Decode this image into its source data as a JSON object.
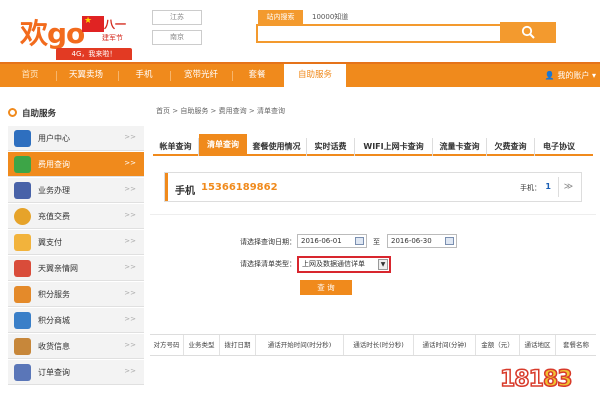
{
  "header": {
    "logo_text": "go",
    "promo_title": "八一",
    "promo_sub": "建军节",
    "badge": "4G，我来啦！",
    "region_1": "江苏",
    "region_2": "南京",
    "search_label": "站内搜索",
    "search_hint": "10000知道",
    "search_value": ""
  },
  "nav": {
    "items": [
      "首页",
      "天翼卖场",
      "手机",
      "宽带光纤",
      "套餐",
      "自助服务"
    ],
    "account": "我的账户"
  },
  "sidebar": {
    "title": "自助服务",
    "items": [
      {
        "label": "用户中心",
        "icon": "user-icon"
      },
      {
        "label": "费用查询",
        "icon": "search-icon"
      },
      {
        "label": "业务办理",
        "icon": "list-icon"
      },
      {
        "label": "充值交费",
        "icon": "yen-icon"
      },
      {
        "label": "翼支付",
        "icon": "wallet-icon"
      },
      {
        "label": "天翼亲情网",
        "icon": "family-icon"
      },
      {
        "label": "积分服务",
        "icon": "points-icon"
      },
      {
        "label": "积分商城",
        "icon": "mall-icon"
      },
      {
        "label": "收货信息",
        "icon": "box-icon"
      },
      {
        "label": "订单查询",
        "icon": "order-icon"
      }
    ],
    "arrow": ">>"
  },
  "breadcrumb": "首页 > 自助服务 > 费用查询 > 清单查询",
  "tabs": [
    "帐单查询",
    "清单查询",
    "套餐使用情况",
    "实时话费",
    "WIFI上网卡查询",
    "流量卡查询",
    "欠费查询",
    "电子协议"
  ],
  "phone": {
    "label": "手机",
    "number": "15366189862",
    "count_label": "手机：",
    "count": "1",
    "toggle": "≫"
  },
  "query": {
    "date_label": "请选择查询日期：",
    "start_date": "2016-06-01",
    "to": "至",
    "end_date": "2016-06-30",
    "type_label": "请选择清单类型：",
    "type_value": "上网及数据通信详单",
    "button": "查 询"
  },
  "table": {
    "headers": [
      "对方号码",
      "业务类型",
      "拨打日期",
      "通话开始时间(时分秒)",
      "通话时长(时分秒)",
      "通话时间(分钟)",
      "金额（元）",
      "通话地区",
      "套餐名称"
    ]
  },
  "watermark": {
    "a": "181",
    "b": "83"
  },
  "colors": {
    "brand_orange": "#f08a1c",
    "highlight_red": "#d8262e"
  }
}
